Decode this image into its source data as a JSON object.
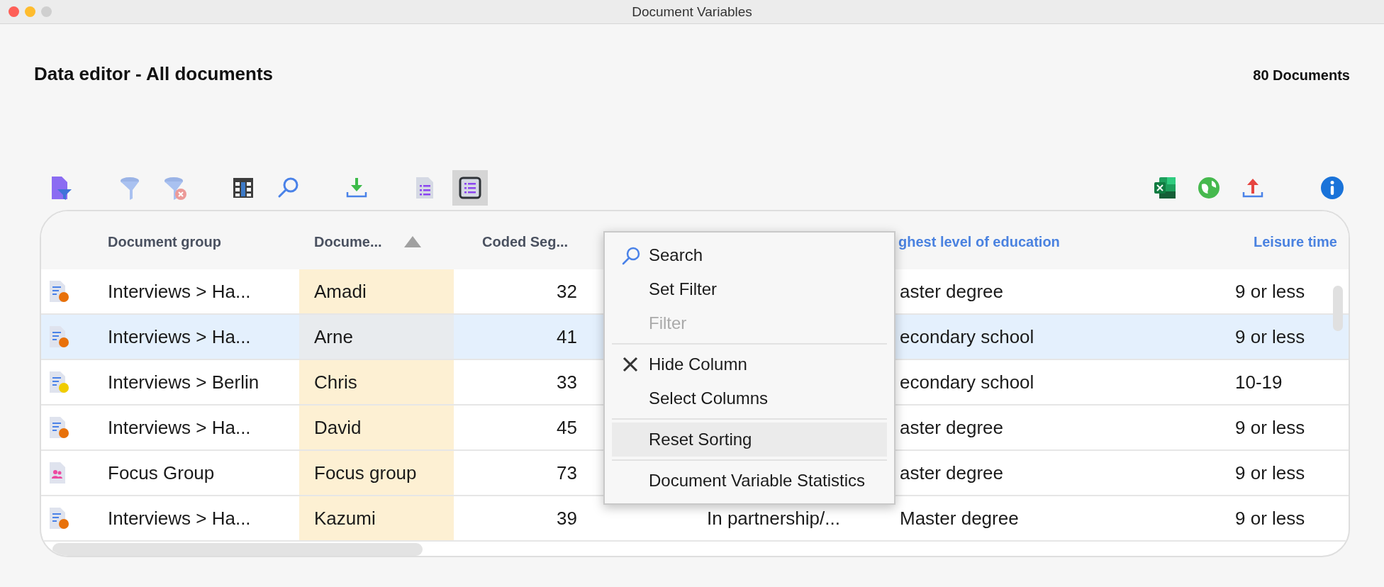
{
  "window": {
    "title": "Document Variables"
  },
  "header": {
    "title": "Data editor - All documents",
    "count": "80 Documents"
  },
  "toolbar": {
    "left_groups": [
      [
        {
          "kind": "doc-filter",
          "selected": false
        }
      ],
      [
        {
          "kind": "filter",
          "selected": false
        },
        {
          "kind": "filter-clear",
          "selected": false
        }
      ],
      [
        {
          "kind": "columns",
          "selected": false
        },
        {
          "kind": "search",
          "selected": false
        }
      ],
      [
        {
          "kind": "download",
          "selected": false
        }
      ],
      [
        {
          "kind": "doc-list",
          "selected": false
        },
        {
          "kind": "list-view",
          "selected": true
        }
      ]
    ],
    "right": [
      {
        "kind": "excel",
        "selected": false
      },
      {
        "kind": "globe",
        "selected": false
      },
      {
        "kind": "upload",
        "selected": false
      },
      {
        "kind": "info",
        "selected": false
      }
    ]
  },
  "table": {
    "columns": [
      {
        "label": "Document group",
        "sorted": false,
        "linked": false
      },
      {
        "label": "Docume...",
        "sorted": true,
        "linked": false
      },
      {
        "label": "Coded Seg...",
        "sorted": false,
        "linked": false
      },
      {
        "label": "ghest level of education",
        "sorted": false,
        "linked": true
      },
      {
        "label": "Leisure time",
        "sorted": false,
        "linked": true
      }
    ],
    "rows": [
      {
        "icon": {
          "kind": "text",
          "color": "#e8710a"
        },
        "selected": false,
        "document_group": "Interviews > Ha...",
        "document_name": "Amadi",
        "coded_segments": "32",
        "column_5": "aster degree",
        "leisure_time": "9 or less"
      },
      {
        "icon": {
          "kind": "text",
          "color": "#e8710a"
        },
        "selected": true,
        "document_group": "Interviews > Ha...",
        "document_name": "Arne",
        "coded_segments": "41",
        "column_5": "econdary school",
        "leisure_time": "9 or less"
      },
      {
        "icon": {
          "kind": "text",
          "color": "#f0cc00"
        },
        "selected": false,
        "document_group": "Interviews > Berlin",
        "document_name": "Chris",
        "coded_segments": "33",
        "column_5": "econdary school",
        "leisure_time": "10-19"
      },
      {
        "icon": {
          "kind": "text",
          "color": "#e8710a"
        },
        "selected": false,
        "document_group": "Interviews > Ha...",
        "document_name": "David",
        "coded_segments": "45",
        "column_5": "aster degree",
        "leisure_time": "9 or less"
      },
      {
        "icon": {
          "kind": "group"
        },
        "selected": false,
        "document_group": "Focus Group",
        "document_name": "Focus group",
        "coded_segments": "73",
        "column_5": "aster degree",
        "leisure_time": "9 or less"
      },
      {
        "icon": {
          "kind": "text",
          "color": "#e8710a"
        },
        "selected": false,
        "document_group": "Interviews > Ha...",
        "document_name": "Kazumi",
        "coded_segments": "39",
        "column_4": "In partnership/...",
        "column_5": "Master degree",
        "leisure_time": "9 or less"
      }
    ]
  },
  "context_menu": {
    "items": [
      {
        "kind": "search",
        "label": "Search",
        "disabled": false,
        "highlighted": false
      },
      {
        "kind": "item",
        "label": "Set Filter",
        "disabled": false,
        "highlighted": false
      },
      {
        "kind": "item",
        "label": "Filter",
        "disabled": true,
        "highlighted": false
      },
      {
        "kind": "separator"
      },
      {
        "kind": "hide",
        "label": "Hide Column",
        "disabled": false,
        "highlighted": false
      },
      {
        "kind": "item",
        "label": "Select Columns",
        "disabled": false,
        "highlighted": false
      },
      {
        "kind": "separator"
      },
      {
        "kind": "item",
        "label": "Reset Sorting",
        "disabled": false,
        "highlighted": true
      },
      {
        "kind": "separator"
      },
      {
        "kind": "item",
        "label": "Document Variable Statistics",
        "disabled": false,
        "highlighted": false
      }
    ]
  }
}
